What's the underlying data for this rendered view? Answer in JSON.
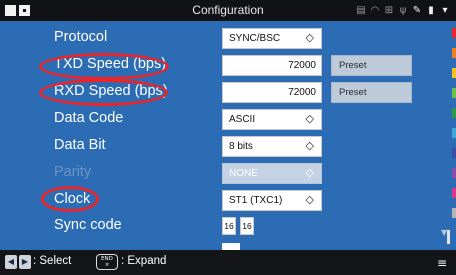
{
  "titlebar": {
    "title": "Configuration",
    "status_icons": [
      "printer-icon",
      "wifi-icon",
      "network-icon",
      "usb-icon",
      "tool-icon",
      "sd-card-icon",
      "battery-icon"
    ]
  },
  "rows": {
    "protocol": {
      "label": "Protocol",
      "value": "SYNC/BSC"
    },
    "txd_speed": {
      "label": "TXD Speed (bps)",
      "value": "72000",
      "preset": "Preset"
    },
    "rxd_speed": {
      "label": "RXD Speed (bps)",
      "value": "72000",
      "preset": "Preset"
    },
    "data_code": {
      "label": "Data Code",
      "value": "ASCII"
    },
    "data_bit": {
      "label": "Data Bit",
      "value": "8 bits"
    },
    "parity": {
      "label": "Parity",
      "value": "NONE"
    },
    "clock": {
      "label": "Clock",
      "value": "ST1 (TXC1)"
    },
    "sync_code": {
      "label": "Sync code",
      "value1": "16",
      "value2": "16"
    }
  },
  "footer": {
    "select_text": ": Select",
    "end_key_top": "END",
    "end_key_bottom": "×",
    "expand_text": ": Expand"
  },
  "colors": {
    "background": "#2b6cb4",
    "highlight_ellipse": "#e8252b",
    "strip": [
      "#e8262a",
      "#f08020",
      "#f3c422",
      "#6cc04a",
      "#2f9a4a",
      "#3fa6d8",
      "#3a4fa8",
      "#8a4ea6",
      "#d9398a",
      "#b5b5b5"
    ]
  }
}
